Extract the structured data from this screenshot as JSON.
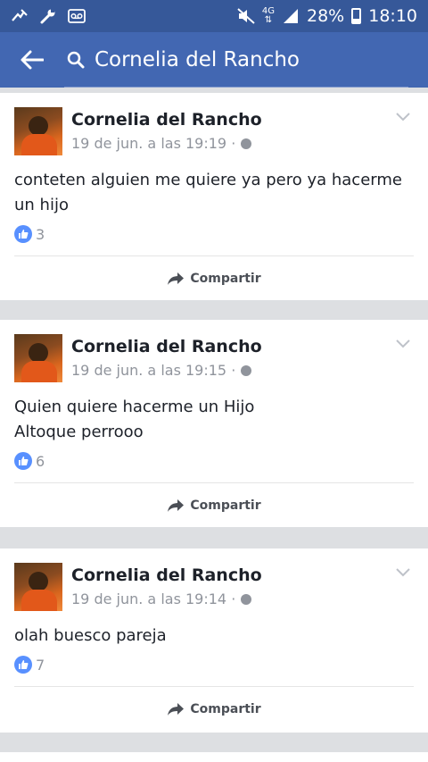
{
  "status_bar": {
    "signal_label": "4G",
    "battery": "28%",
    "time": "18:10",
    "icons": [
      "mute-icon",
      "wrench-icon",
      "voicemail-icon",
      "signal-icon",
      "battery-icon"
    ]
  },
  "app_bar": {
    "search_query": "Cornelia del Rancho"
  },
  "posts": [
    {
      "author": "Cornelia del Rancho",
      "time": "19 de jun. a las 19:19 ·",
      "text": "conteten alguien me quiere ya pero ya hacerme un hijo",
      "likes": "3",
      "share_label": "Compartir"
    },
    {
      "author": "Cornelia del Rancho",
      "time": "19 de jun. a las 19:15 ·",
      "text": "Quien quiere hacerme un Hijo\nAltoque perrooo",
      "likes": "6",
      "share_label": "Compartir"
    },
    {
      "author": "Cornelia del Rancho",
      "time": "19 de jun. a las 19:14 ·",
      "text": "olah buesco pareja",
      "likes": "7",
      "share_label": "Compartir"
    }
  ],
  "colors": {
    "status_bar": "#365899",
    "app_bar": "#4267b2",
    "like_badge": "#5890ff",
    "feed_bg": "#dddfe2"
  }
}
